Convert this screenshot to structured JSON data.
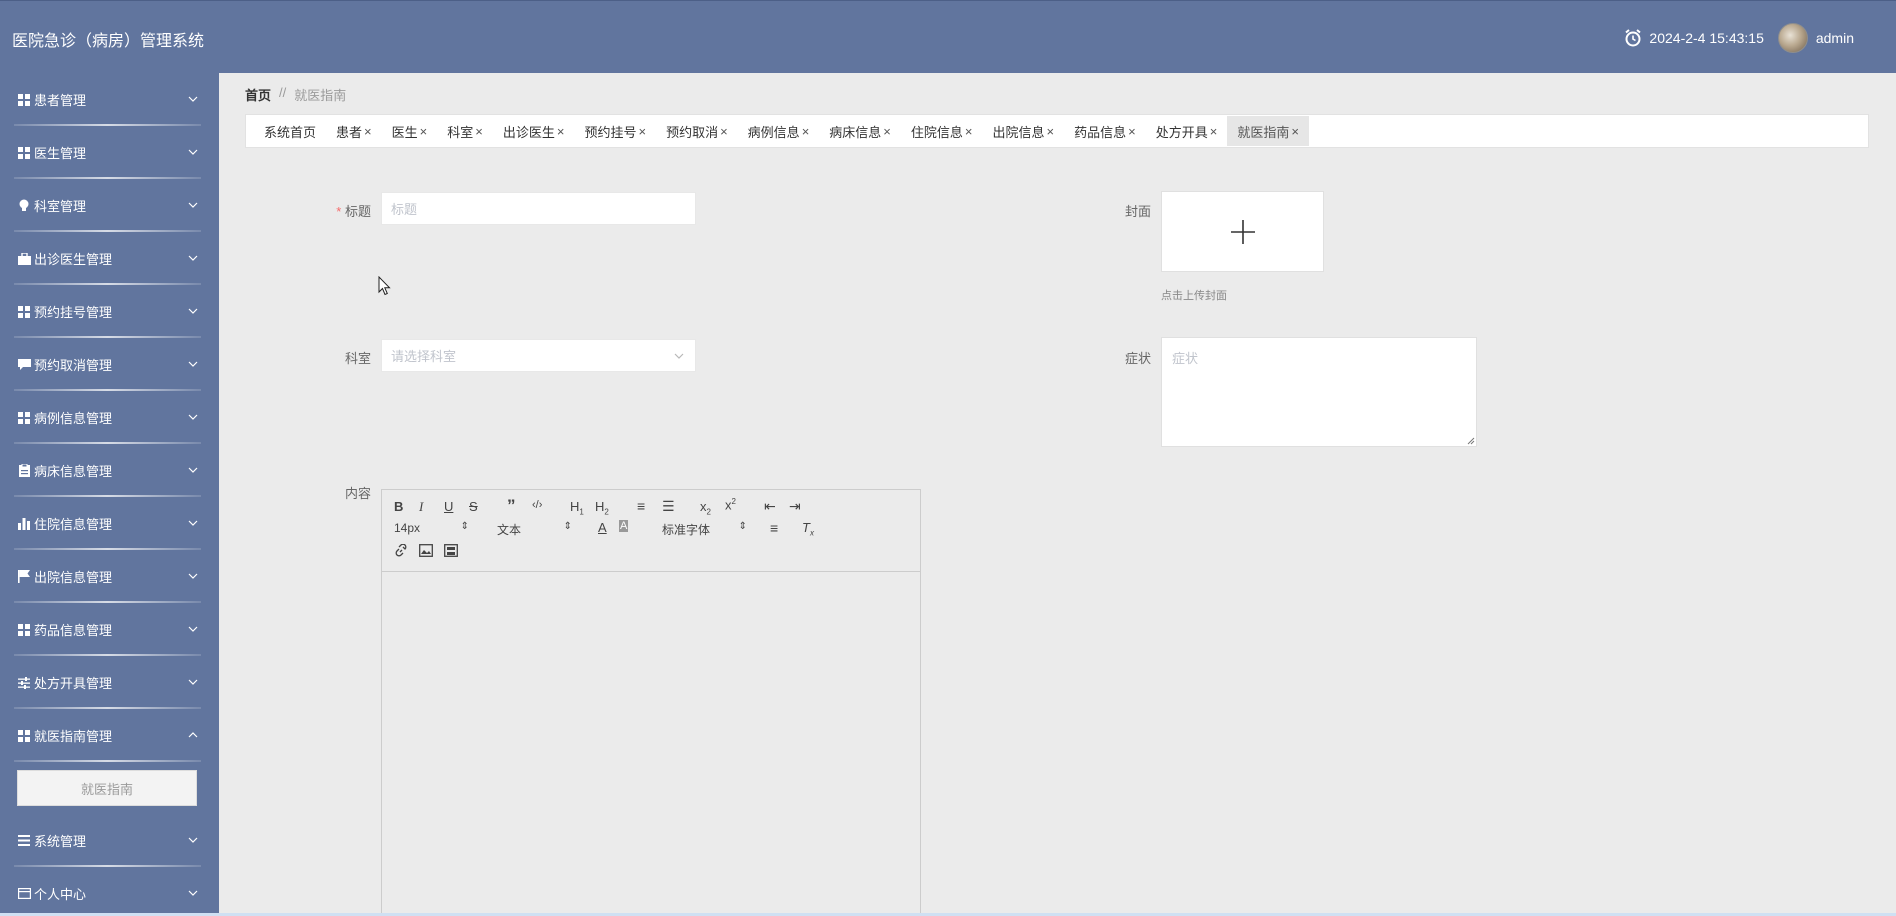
{
  "app": {
    "title": "医院急诊（病房）管理系统",
    "datetime": "2024-2-4 15:43:15",
    "username": "admin"
  },
  "sidebar": {
    "items": [
      {
        "label": "患者管理",
        "icon": "grid-icon"
      },
      {
        "label": "医生管理",
        "icon": "grid-icon"
      },
      {
        "label": "科室管理",
        "icon": "bulb-icon"
      },
      {
        "label": "出诊医生管理",
        "icon": "briefcase-icon"
      },
      {
        "label": "预约挂号管理",
        "icon": "grid-icon"
      },
      {
        "label": "预约取消管理",
        "icon": "chat-icon"
      },
      {
        "label": "病例信息管理",
        "icon": "grid-icon"
      },
      {
        "label": "病床信息管理",
        "icon": "clipboard-icon"
      },
      {
        "label": "住院信息管理",
        "icon": "bar-chart-icon"
      },
      {
        "label": "出院信息管理",
        "icon": "flag-icon"
      },
      {
        "label": "药品信息管理",
        "icon": "grid-icon"
      },
      {
        "label": "处方开具管理",
        "icon": "sliders-icon"
      },
      {
        "label": "就医指南管理",
        "icon": "grid-icon",
        "expanded": true,
        "subitems": [
          "就医指南"
        ]
      },
      {
        "label": "系统管理",
        "icon": "list-icon"
      },
      {
        "label": "个人中心",
        "icon": "card-icon"
      }
    ]
  },
  "breadcrumb": {
    "home": "首页",
    "separator": "//",
    "current": "就医指南"
  },
  "tabs": [
    {
      "label": "系统首页",
      "closable": false
    },
    {
      "label": "患者",
      "closable": true
    },
    {
      "label": "医生",
      "closable": true
    },
    {
      "label": "科室",
      "closable": true
    },
    {
      "label": "出诊医生",
      "closable": true
    },
    {
      "label": "预约挂号",
      "closable": true
    },
    {
      "label": "预约取消",
      "closable": true
    },
    {
      "label": "病例信息",
      "closable": true
    },
    {
      "label": "病床信息",
      "closable": true
    },
    {
      "label": "住院信息",
      "closable": true
    },
    {
      "label": "出院信息",
      "closable": true
    },
    {
      "label": "药品信息",
      "closable": true
    },
    {
      "label": "处方开具",
      "closable": true
    },
    {
      "label": "就医指南",
      "closable": true,
      "active": true
    }
  ],
  "form": {
    "title_label": "标题",
    "title_required": "*",
    "title_placeholder": "标题",
    "cover_label": "封面",
    "cover_hint": "点击上传封面",
    "dept_label": "科室",
    "dept_placeholder": "请选择科室",
    "symptom_label": "症状",
    "symptom_placeholder": "症状",
    "content_label": "内容"
  },
  "editor": {
    "font_size": "14px",
    "header_format": "文本",
    "font_family": "标准字体"
  },
  "colors": {
    "header_bg": "#61759e",
    "sidebar_bg": "#61759e",
    "page_bg": "#ebebeb",
    "required": "#f56c6c"
  }
}
